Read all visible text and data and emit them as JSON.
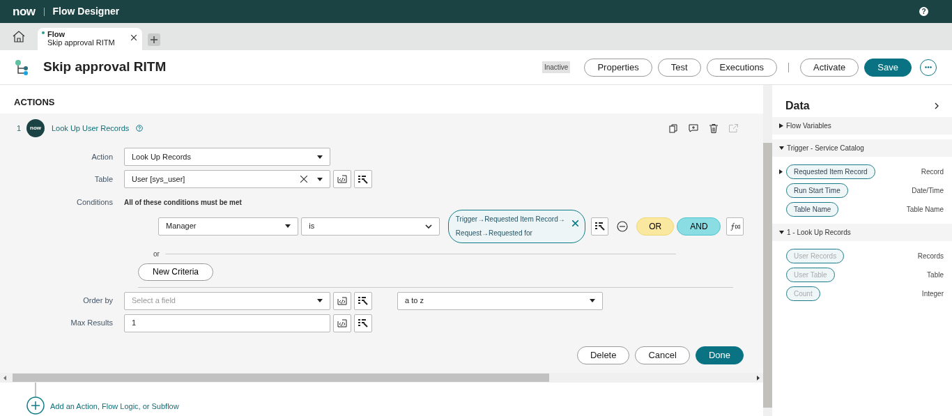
{
  "top_bar": {
    "logo": "now",
    "product": "Flow Designer",
    "help": "?"
  },
  "tabs": [
    {
      "type": "Flow",
      "title": "Skip approval RITM",
      "selected": true,
      "modified": true
    }
  ],
  "header": {
    "title": "Skip approval RITM",
    "status": "Inactive",
    "button_groups": [
      [
        {
          "label": "Properties",
          "primary": false
        },
        {
          "label": "Test",
          "primary": false
        },
        {
          "label": "Executions",
          "primary": false
        }
      ],
      [
        {
          "label": "Activate",
          "primary": false
        },
        {
          "label": "Save",
          "primary": true
        }
      ]
    ]
  },
  "actions": {
    "heading": "ACTIONS",
    "step": {
      "number": "1",
      "app_logo": "now",
      "name": "Look Up User Records",
      "action": {
        "label": "Action",
        "value": "Look Up Records"
      },
      "table": {
        "label": "Table",
        "value": "User [sys_user]"
      },
      "conditions": {
        "label": "Conditions",
        "summary": "All of these conditions must be met",
        "rows": [
          {
            "field": "Manager",
            "operator": "is",
            "value": "Trigger→Requested Item Record→Request→Requested for"
          }
        ],
        "or_label": "or",
        "or_button": "OR",
        "and_button": "AND",
        "new_criteria": "New Criteria"
      },
      "order_by": {
        "label": "Order by",
        "placeholder": "Select a field",
        "direction": "a to z"
      },
      "max_results": {
        "label": "Max Results",
        "value": "1"
      },
      "buttons": [
        {
          "label": "Delete",
          "primary": false
        },
        {
          "label": "Cancel",
          "primary": false
        },
        {
          "label": "Done",
          "primary": true
        }
      ]
    },
    "add_action": "Add an Action, Flow Logic, or Subflow"
  },
  "data_panel": {
    "title": "Data",
    "sections": [
      {
        "title": "Flow Variables",
        "expanded": false
      },
      {
        "title": "Trigger - Service Catalog",
        "expanded": true,
        "items": [
          {
            "name": "Requested Item Record",
            "type": "Record",
            "expandable": true,
            "dimmed": false
          },
          {
            "name": "Run Start Time",
            "type": "Date/Time",
            "expandable": false,
            "dimmed": false
          },
          {
            "name": "Table Name",
            "type": "Table Name",
            "expandable": false,
            "dimmed": false
          }
        ]
      },
      {
        "title": "1 - Look Up Records",
        "expanded": true,
        "items": [
          {
            "name": "User Records",
            "type": "Records",
            "expandable": false,
            "dimmed": true
          },
          {
            "name": "User Table",
            "type": "Table",
            "expandable": false,
            "dimmed": true
          },
          {
            "name": "Count",
            "type": "Integer",
            "expandable": false,
            "dimmed": true
          }
        ]
      }
    ]
  }
}
